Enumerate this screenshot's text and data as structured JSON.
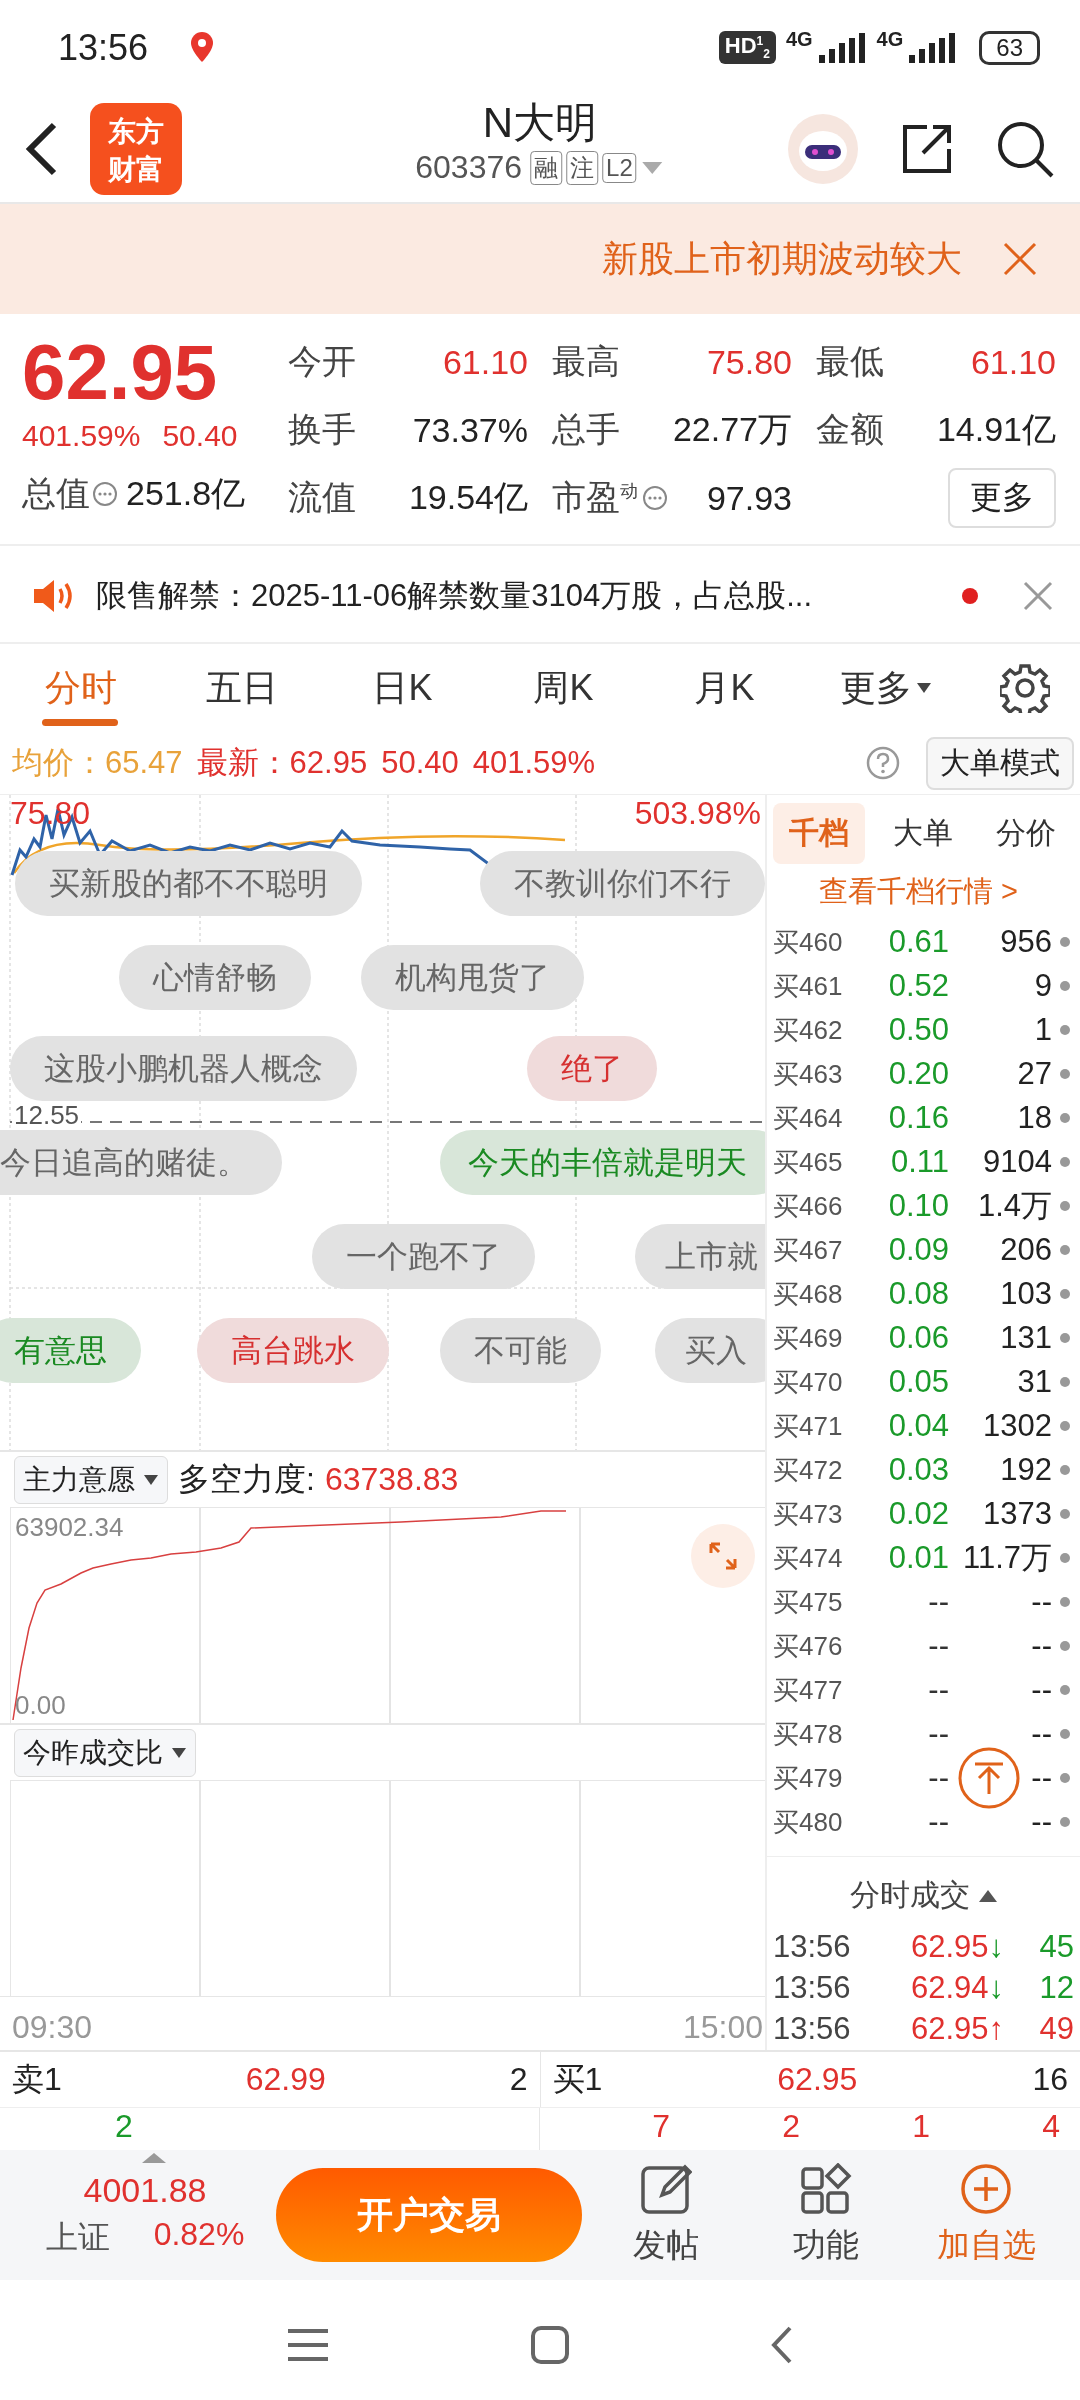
{
  "status_bar": {
    "time": "13:56",
    "hd": "HD$^{1}$$_{2}$",
    "networks": [
      "4G",
      "4G"
    ],
    "battery": "63"
  },
  "header": {
    "logo": [
      "东方",
      "财富"
    ],
    "title": "N大明",
    "code": "603376",
    "tags": [
      "融",
      "注",
      "L2"
    ]
  },
  "alert": {
    "text": "新股上市初期波动较大"
  },
  "quote": {
    "price": "62.95",
    "change_pct": "401.59%",
    "change": "50.40",
    "total_value": {
      "label": "总值",
      "value": "251.8亿",
      "info": true
    },
    "stats": [
      {
        "label": "今开",
        "value": "61.10",
        "color": "#e0312e",
        "info": false
      },
      {
        "label": "最高",
        "value": "75.80",
        "color": "#e0312e",
        "info": false
      },
      {
        "label": "最低",
        "value": "61.10",
        "color": "#e0312e",
        "info": false
      },
      {
        "label": "换手",
        "value": "73.37%",
        "color": "#222222",
        "info": false
      },
      {
        "label": "总手",
        "value": "22.77万",
        "color": "#222222",
        "info": false
      },
      {
        "label": "金额",
        "value": "14.91亿",
        "color": "#222222",
        "info": false
      },
      {
        "label": "流值",
        "value": "19.54亿",
        "color": "#222222",
        "info": false
      },
      {
        "label": "市盈$^{动}$",
        "value": "97.93",
        "color": "#222222",
        "info": true
      }
    ],
    "more_button": "更多"
  },
  "notice": {
    "text": "限售解禁：2025-11-06解禁数量3104万股，占总股...",
    "unread": true
  },
  "tabs": [
    {
      "label": "分时",
      "selected": true,
      "dropdown": false
    },
    {
      "label": "五日",
      "selected": false,
      "dropdown": false
    },
    {
      "label": "日K",
      "selected": false,
      "dropdown": false
    },
    {
      "label": "周K",
      "selected": false,
      "dropdown": false
    },
    {
      "label": "月K",
      "selected": false,
      "dropdown": false
    },
    {
      "label": "更多",
      "selected": false,
      "dropdown": true
    }
  ],
  "info_row": {
    "avg_label": "均价：",
    "avg": "65.47",
    "latest_label": "最新：",
    "latest": "62.95",
    "change": "50.40",
    "change_pct": "401.59%",
    "mode_button": "大单模式"
  },
  "price_chart": {
    "high": "75.80",
    "high_pct": "503.98%",
    "ref": "12.55"
  },
  "comments": [
    {
      "text": "买新股的都不不聪明",
      "color": "#666666"
    },
    {
      "text": "不教训你们不行",
      "color": "#666666"
    },
    {
      "text": "心情舒畅",
      "color": "#666666"
    },
    {
      "text": "机构甩货了",
      "color": "#666666"
    },
    {
      "text": "这股小鹏机器人概念",
      "color": "#666666"
    },
    {
      "text": "绝了",
      "color": "#d63030"
    },
    {
      "text": "今日追高的赌徒。",
      "color": "#666666"
    },
    {
      "text": "今天的丰倍就是明天",
      "color": "#1a8a22"
    },
    {
      "text": "一个跑不了",
      "color": "#666666"
    },
    {
      "text": "上市就",
      "color": "#666666"
    },
    {
      "text": "有意思",
      "color": "#1a8a22"
    },
    {
      "text": "高台跳水",
      "color": "#d63030"
    },
    {
      "text": "不可能",
      "color": "#666666"
    },
    {
      "text": "买入",
      "color": "#666666"
    }
  ],
  "indicator_1": {
    "selector": "主力意愿",
    "label": "多空力度:",
    "value": "63738.83",
    "max": "63902.34",
    "min": "0.00"
  },
  "indicator_2": {
    "selector": "今昨成交比"
  },
  "time_axis": [
    "09:30",
    "15:00"
  ],
  "order_book": {
    "tabs": [
      {
        "label": "千档",
        "selected": true
      },
      {
        "label": "大单",
        "selected": false
      },
      {
        "label": "分价",
        "selected": false
      }
    ],
    "link": "查看千档行情 >",
    "rows": [
      {
        "label": "买460",
        "price": "0.61",
        "volume": "956",
        "color": "#1a9a2a"
      },
      {
        "label": "买461",
        "price": "0.52",
        "volume": "9",
        "color": "#1a9a2a"
      },
      {
        "label": "买462",
        "price": "0.50",
        "volume": "1",
        "color": "#1a9a2a"
      },
      {
        "label": "买463",
        "price": "0.20",
        "volume": "27",
        "color": "#1a9a2a"
      },
      {
        "label": "买464",
        "price": "0.16",
        "volume": "18",
        "color": "#1a9a2a"
      },
      {
        "label": "买465",
        "price": "0.11",
        "volume": "9104",
        "color": "#1a9a2a"
      },
      {
        "label": "买466",
        "price": "0.10",
        "volume": "1.4万",
        "color": "#1a9a2a"
      },
      {
        "label": "买467",
        "price": "0.09",
        "volume": "206",
        "color": "#1a9a2a"
      },
      {
        "label": "买468",
        "price": "0.08",
        "volume": "103",
        "color": "#1a9a2a"
      },
      {
        "label": "买469",
        "price": "0.06",
        "volume": "131",
        "color": "#1a9a2a"
      },
      {
        "label": "买470",
        "price": "0.05",
        "volume": "31",
        "color": "#1a9a2a"
      },
      {
        "label": "买471",
        "price": "0.04",
        "volume": "1302",
        "color": "#1a9a2a"
      },
      {
        "label": "买472",
        "price": "0.03",
        "volume": "192",
        "color": "#1a9a2a"
      },
      {
        "label": "买473",
        "price": "0.02",
        "volume": "1373",
        "color": "#1a9a2a"
      },
      {
        "label": "买474",
        "price": "0.01",
        "volume": "11.7万",
        "color": "#1a9a2a"
      },
      {
        "label": "买475",
        "price": "--",
        "volume": "--",
        "color": "#333333"
      },
      {
        "label": "买476",
        "price": "--",
        "volume": "--",
        "color": "#333333"
      },
      {
        "label": "买477",
        "price": "--",
        "volume": "--",
        "color": "#333333"
      },
      {
        "label": "买478",
        "price": "--",
        "volume": "--",
        "color": "#333333"
      },
      {
        "label": "买479",
        "price": "--",
        "volume": "--",
        "color": "#333333"
      },
      {
        "label": "买480",
        "price": "--",
        "volume": "--",
        "color": "#333333"
      }
    ],
    "trades_header": "分时成交",
    "trades": [
      {
        "time": "13:56",
        "price": "62.95",
        "arrow": "↓",
        "volume": "45",
        "color": "#1a9a2a"
      },
      {
        "time": "13:56",
        "price": "62.94",
        "arrow": "↓",
        "volume": "12",
        "color": "#1a9a2a"
      },
      {
        "time": "13:56",
        "price": "62.95",
        "arrow": "↑",
        "volume": "49",
        "color": "#e0312e"
      }
    ]
  },
  "level_1": {
    "sell": {
      "label": "卖1",
      "price": "62.99",
      "volume": "2"
    },
    "buy": {
      "label": "买1",
      "price": "62.95",
      "volume": "16"
    }
  },
  "level_counts": {
    "sell": [
      "2"
    ],
    "buy": [
      "7",
      "2",
      "1",
      "4"
    ]
  },
  "bottom_bar": {
    "index_value": "4001.88",
    "index_name": "上证",
    "index_pct": "0.82%",
    "trade_button": "开户交易",
    "actions": [
      {
        "label": "发帖",
        "highlight": false
      },
      {
        "label": "功能",
        "highlight": false
      },
      {
        "label": "加自选",
        "highlight": true
      }
    ]
  }
}
